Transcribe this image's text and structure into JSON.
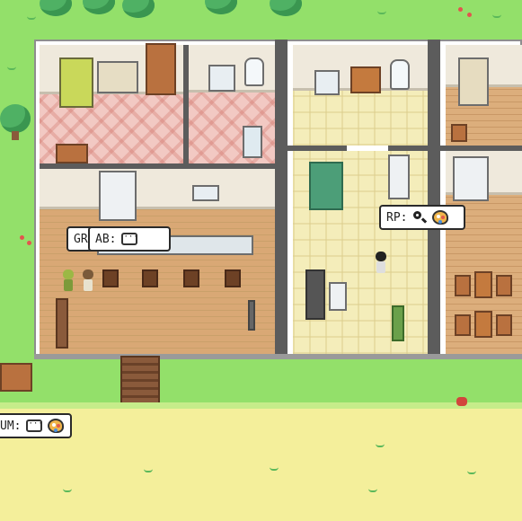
{
  "scene": "Pixel-art town map: multi-room house with kitchen, bedrooms, bathrooms and agents",
  "colors": {
    "grass": "#93e06a",
    "sand": "#f4ef9b",
    "wall": "#ffffff",
    "wood_floor": "#d9a875",
    "pink_floor": "#f2c9c3",
    "cream_floor": "#f4edba",
    "bubble_border": "#2a2a2a"
  },
  "agents": [
    {
      "id": "gr",
      "label": "GR",
      "icons": [
        "chat-icon"
      ]
    },
    {
      "id": "ab",
      "label": "AB:",
      "icons": [
        "chat-icon"
      ]
    },
    {
      "id": "rp",
      "label": "RP:",
      "icons": [
        "magnifier-icon",
        "palette-icon"
      ]
    },
    {
      "id": "um",
      "label": "UM:",
      "icons": [
        "chat-icon",
        "palette-icon"
      ]
    }
  ],
  "rooms": [
    "bedroom-left",
    "bathroom-left",
    "kitchen-cafe",
    "hallway-right",
    "bathroom-right",
    "bedroom-right",
    "dining-right"
  ],
  "chat_glyph": "···"
}
